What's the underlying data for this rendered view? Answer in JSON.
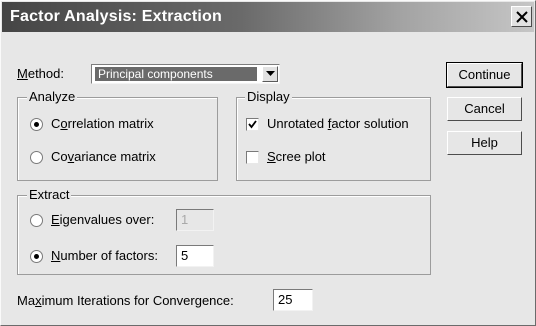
{
  "dialog": {
    "title": "Factor Analysis: Extraction"
  },
  "method": {
    "label_pre": "",
    "label_ul": "M",
    "label_post": "ethod:",
    "selected": "Principal components"
  },
  "analyze": {
    "title": "Analyze",
    "correlation": {
      "pre": "C",
      "ul": "o",
      "post": "rrelation matrix",
      "selected": true
    },
    "covariance": {
      "pre": "Co",
      "ul": "v",
      "post": "ariance matrix",
      "selected": false
    }
  },
  "display": {
    "title": "Display",
    "unrotated": {
      "pre": "Unrotated ",
      "ul": "f",
      "post": "actor solution",
      "checked": true
    },
    "scree": {
      "pre": "",
      "ul": "S",
      "post": "cree plot",
      "checked": false
    }
  },
  "extract": {
    "title": "Extract",
    "eigen": {
      "pre": "",
      "ul": "E",
      "post": "igenvalues over:",
      "value": "1",
      "selected": false
    },
    "nfactors": {
      "pre": "",
      "ul": "N",
      "post": "umber of factors:",
      "value": "5",
      "selected": true
    }
  },
  "max_iter": {
    "pre": "Ma",
    "ul": "x",
    "post": "imum Iterations for Convergence:",
    "value": "25"
  },
  "buttons": {
    "continue": "Continue",
    "cancel": "Cancel",
    "help": "Help"
  }
}
